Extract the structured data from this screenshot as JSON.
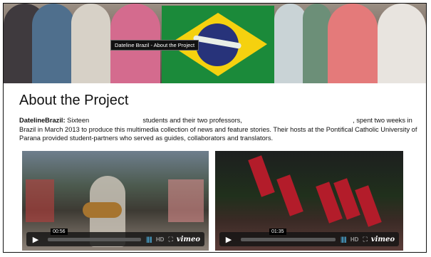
{
  "hero": {
    "tooltip": "Dateline Brazil - About the Project"
  },
  "page": {
    "title": "About the Project",
    "intro_lead": "DatelineBrazil:",
    "intro_part1": " Sixteen ",
    "intro_part2": " students and their two professors, ",
    "intro_part3": " , spent two weeks in Brazil in March 2013 to produce this multimedia collection of news and feature stories. Their hosts at the Pontifical Catholic University of Parana provided student-partners who served as guides, collaborators and translators."
  },
  "videos": [
    {
      "time": "00:56",
      "hd_label": "HD",
      "brand": "vimeo"
    },
    {
      "time": "01:35",
      "hd_label": "HD",
      "brand": "vimeo"
    }
  ],
  "colors": {
    "flag_green": "#1b8a3a",
    "flag_yellow": "#f5d10f",
    "flag_blue": "#27337a",
    "player_accent": "#4fb3e3"
  }
}
